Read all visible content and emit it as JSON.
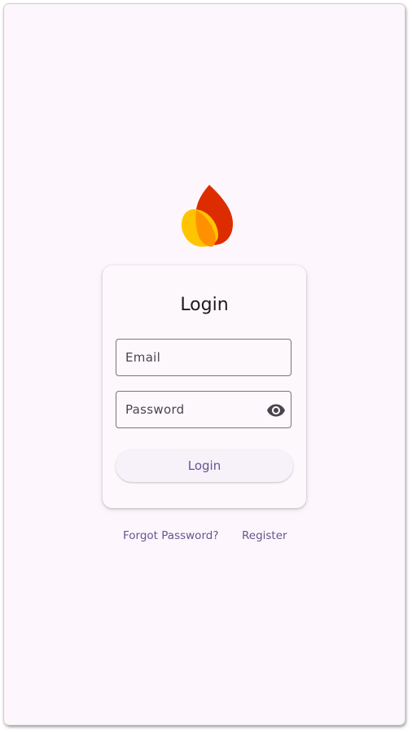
{
  "login": {
    "title": "Login",
    "email": {
      "placeholder": "Email",
      "value": ""
    },
    "password": {
      "placeholder": "Password",
      "value": "",
      "toggle_icon": "eye-icon"
    },
    "submit_label": "Login"
  },
  "links": {
    "forgot_password": "Forgot Password?",
    "register": "Register"
  },
  "colors": {
    "background": "#fdf7fd",
    "card": "#fcf8fc",
    "primary": "#65558f",
    "outline": "#79747e",
    "logo_red": "#dd2c00",
    "logo_orange": "#ff9100",
    "logo_yellow": "#ffc400"
  }
}
